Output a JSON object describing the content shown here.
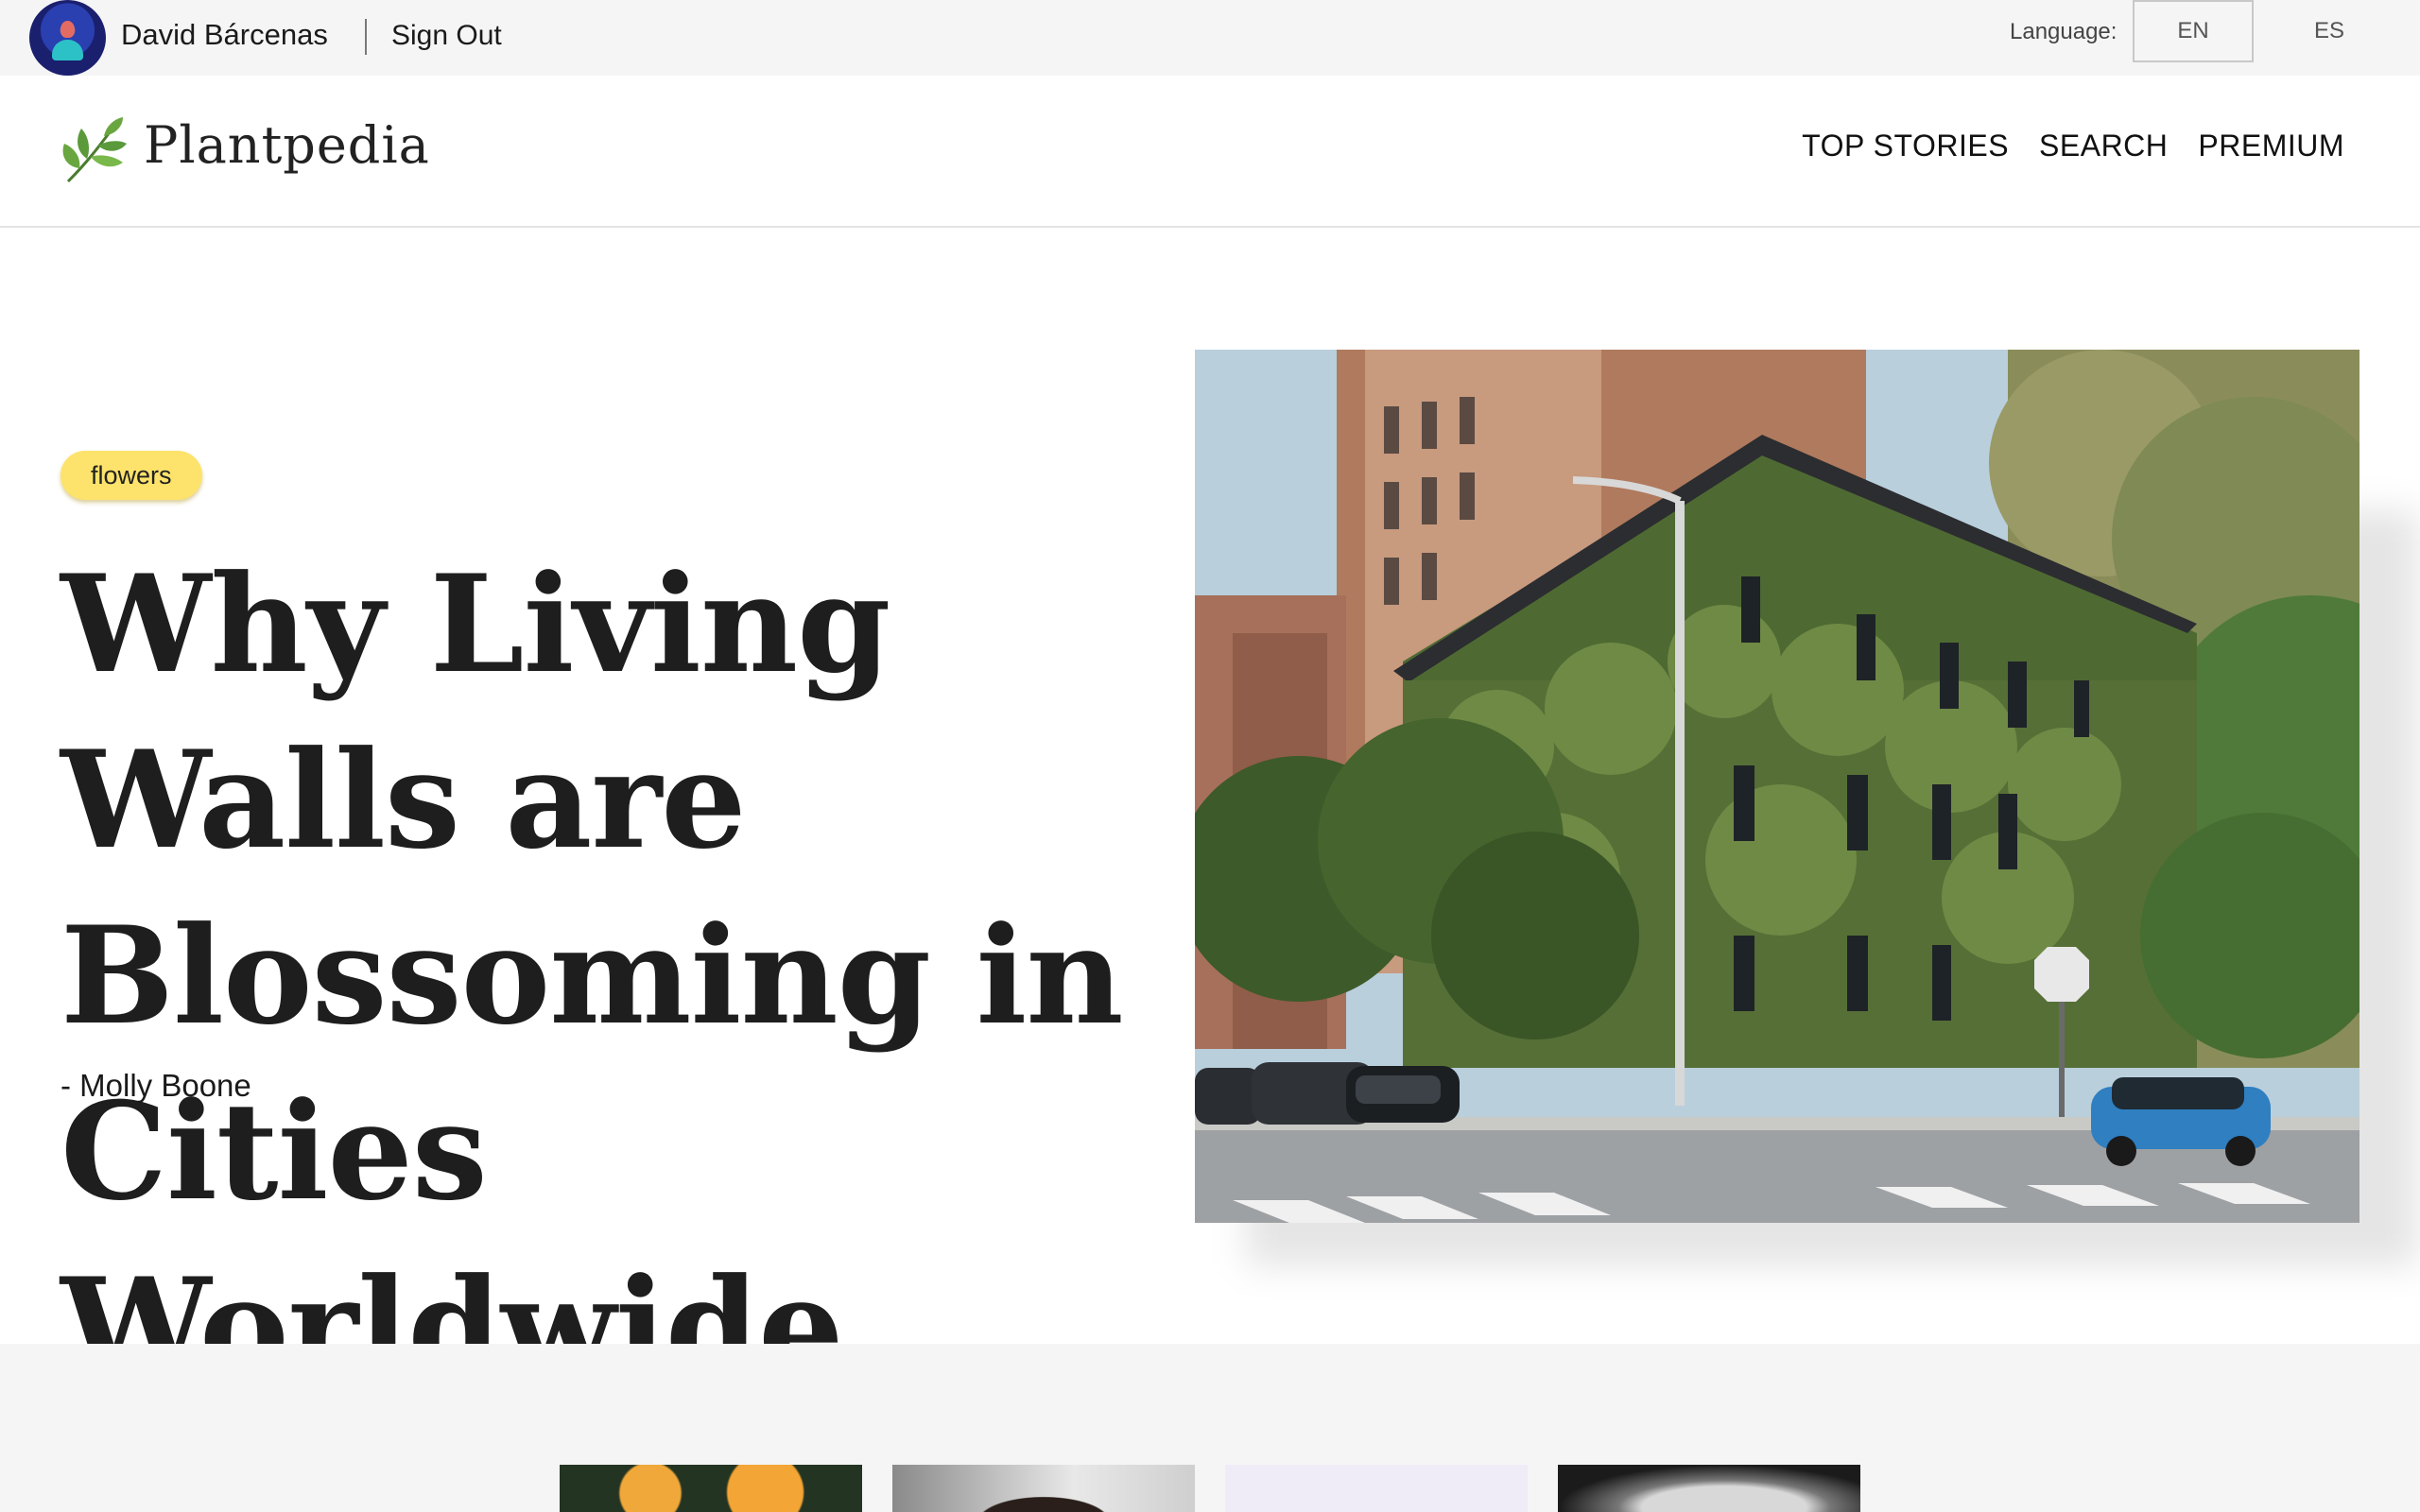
{
  "account": {
    "user_name": "David Bárcenas",
    "sign_out": "Sign Out"
  },
  "language": {
    "label": "Language:",
    "options": [
      "EN",
      "ES"
    ],
    "selected": "EN"
  },
  "header": {
    "logo_text": "Plantpedia",
    "nav": [
      "TOP STORIES",
      "SEARCH",
      "PREMIUM"
    ]
  },
  "hero": {
    "tag": "flowers",
    "headline": "Why Living Walls are Blossoming in Cities Worldwide",
    "author": "- Molly Boone"
  },
  "colors": {
    "topbar_bg": "#f5f5f5",
    "tag_bg": "#fde36b",
    "text": "#1e1e1e",
    "logo_leaf": "#5a9a3a"
  }
}
